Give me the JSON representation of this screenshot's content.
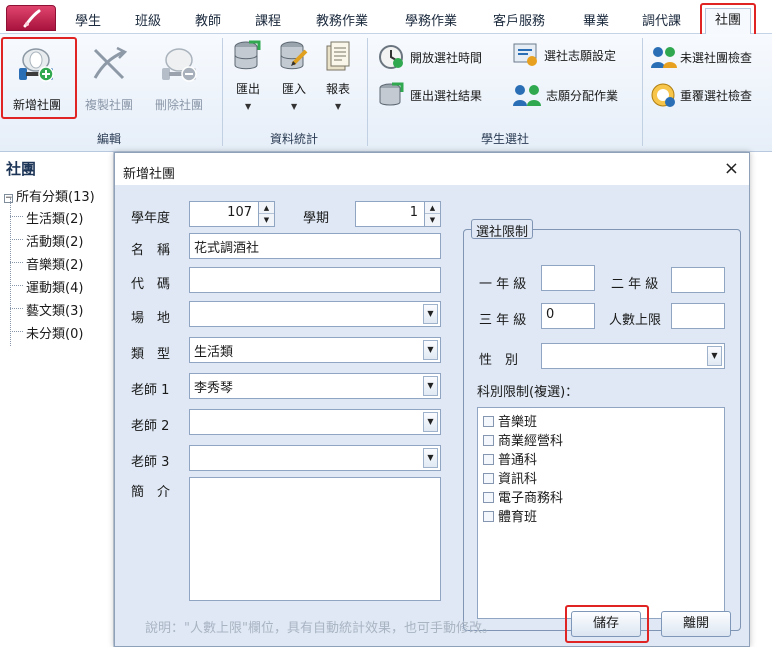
{
  "tabs": [
    "學生",
    "班級",
    "教師",
    "課程",
    "教務作業",
    "學務作業",
    "客戶服務",
    "畢業",
    "調代課"
  ],
  "active_tab": "社團",
  "ribbon": {
    "edit_group": {
      "label": "編輯",
      "add": "新增社團",
      "copy": "複製社團",
      "delete": "刪除社團"
    },
    "data_group": {
      "label": "資料統計",
      "export": "匯出",
      "import": "匯入",
      "report": "報表"
    },
    "select_group": {
      "label": "學生選社",
      "open_time": "開放選社時間",
      "preference_setting": "選社志願設定",
      "export_result": "匯出選社結果",
      "assign": "志願分配作業"
    },
    "check_group": {
      "unselected_check": "未選社團檢查",
      "duplicate_check": "重覆選社檢查"
    }
  },
  "left_panel": {
    "title": "社團",
    "root": "所有分類(13)",
    "items": [
      "生活類(2)",
      "活動類(2)",
      "音樂類(2)",
      "運動類(4)",
      "藝文類(3)",
      "未分類(0)"
    ]
  },
  "dialog": {
    "title": "新增社團",
    "close": "×",
    "fields": {
      "school_year_label": "學年度",
      "school_year_value": "107",
      "semester_label": "學期",
      "semester_value": "1",
      "name_label": "名　稱",
      "name_value": "花式調酒社",
      "code_label": "代　碼",
      "code_value": "",
      "venue_label": "場　地",
      "venue_value": "",
      "type_label": "類　型",
      "type_value": "生活類",
      "teacher1_label": "老師 1",
      "teacher1_value": "李秀琴",
      "teacher2_label": "老師 2",
      "teacher2_value": "",
      "teacher3_label": "老師 3",
      "teacher3_value": "",
      "intro_label": "簡　介"
    },
    "limits": {
      "title": "選社限制",
      "grade1_label": "一 年 級",
      "grade1_value": "",
      "grade2_label": "二 年 級",
      "grade2_value": "",
      "grade3_label": "三 年 級",
      "grade3_value": "0",
      "capacity_label": "人數上限",
      "capacity_value": "",
      "gender_label": "性　別",
      "gender_value": "",
      "dept_label": "科別限制(複選)：",
      "departments": [
        "音樂班",
        "商業經營科",
        "普通科",
        "資訊科",
        "電子商務科",
        "體育班"
      ]
    },
    "hint": "說明：\"人數上限\"欄位，具有自動統計效果，也可手動修改。",
    "save": "儲存",
    "leave": "離開"
  }
}
